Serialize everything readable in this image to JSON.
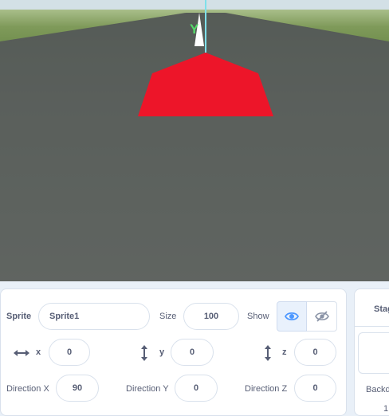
{
  "stage": {
    "axis_label": "Y"
  },
  "sprite_info": {
    "sprite_label": "Sprite",
    "sprite_name": "Sprite1",
    "size_label": "Size",
    "size_value": "100",
    "show_label": "Show",
    "x_label": "x",
    "x_value": "0",
    "y_label": "y",
    "y_value": "0",
    "z_label": "z",
    "z_value": "0",
    "direction_x_label": "Direction X",
    "direction_x_value": "90",
    "direction_y_label": "Direction Y",
    "direction_y_value": "0",
    "direction_z_label": "Direction Z",
    "direction_z_value": "0"
  },
  "stage_pane": {
    "title": "Stag",
    "backdrops_label": "Backd",
    "backdrop_count": "1"
  },
  "colors": {
    "accent": "#4c97ff",
    "object_red": "#ed1529",
    "y_axis": "#56d96a",
    "axis_line": "#7fe0ea"
  },
  "icons": {
    "visible_on": "eye-icon",
    "visible_off": "eye-slash-icon",
    "x_arrows": "horizontal-arrows-icon",
    "y_arrows": "vertical-arrows-icon",
    "z_arrows": "vertical-arrows-icon"
  }
}
